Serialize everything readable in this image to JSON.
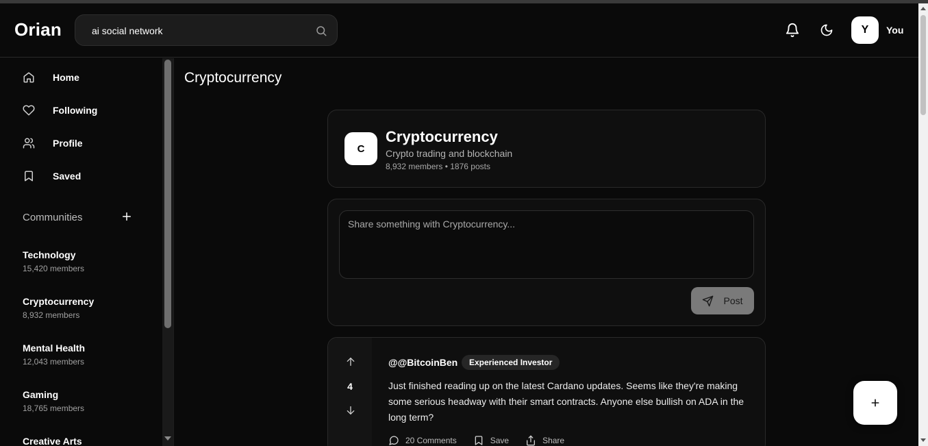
{
  "app": {
    "name": "Orian"
  },
  "search": {
    "value": "ai social network",
    "icon": "search-icon"
  },
  "header": {
    "notifications_icon": "bell-icon",
    "theme_icon": "moon-icon",
    "user": {
      "initial": "Y",
      "name": "You"
    }
  },
  "sidebar": {
    "nav": [
      {
        "label": "Home",
        "icon": "home-icon"
      },
      {
        "label": "Following",
        "icon": "heart-icon"
      },
      {
        "label": "Profile",
        "icon": "users-icon"
      },
      {
        "label": "Saved",
        "icon": "bookmark-icon"
      }
    ],
    "communities_heading": "Communities",
    "communities": [
      {
        "name": "Technology",
        "members": "15,420 members"
      },
      {
        "name": "Cryptocurrency",
        "members": "8,932 members"
      },
      {
        "name": "Mental Health",
        "members": "12,043 members"
      },
      {
        "name": "Gaming",
        "members": "18,765 members"
      },
      {
        "name": "Creative Arts",
        "members": ""
      }
    ]
  },
  "page": {
    "title": "Cryptocurrency"
  },
  "community": {
    "initial": "C",
    "name": "Cryptocurrency",
    "description": "Crypto trading and blockchain",
    "stats": "8,932 members • 1876 posts"
  },
  "composer": {
    "placeholder": "Share something with Cryptocurrency...",
    "post_label": "Post"
  },
  "posts": [
    {
      "score": "4",
      "author": "@@BitcoinBen",
      "badge": "Experienced Investor",
      "body": "Just finished reading up on the latest Cardano updates.  Seems like they're making some serious headway with their smart contracts. Anyone else bullish on ADA in the long term?",
      "comments_label": "20 Comments",
      "save_label": "Save",
      "share_label": "Share"
    }
  ],
  "fab": {
    "label": "+"
  },
  "colors": {
    "background": "#0a0a0a",
    "card": "#0f0f0f",
    "border": "#2a2a2a",
    "post_button": "#7a7a7a"
  }
}
